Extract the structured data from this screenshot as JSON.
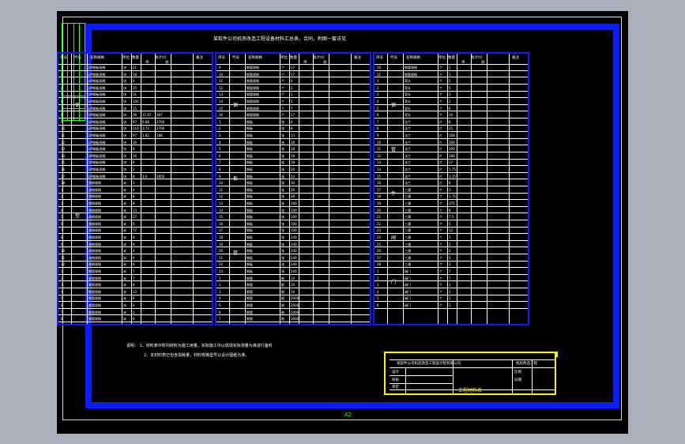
{
  "title": "某软件公司机房改造工程设备材料汇总表，合同，附图一套详见",
  "header": {
    "no": "序号",
    "code": "代号",
    "name": "名称规格",
    "unit": "单位",
    "qty": "数量",
    "total": "总计(t)",
    "sub_a": "单",
    "sub_b": "总",
    "remark": "备注"
  },
  "panels": [
    {
      "groups": [
        "钢",
        "型"
      ],
      "rows": [
        {
          "no": "1",
          "name": "LM钢板规格",
          "unit": "块",
          "qty": "21"
        },
        {
          "no": "2",
          "name": "LM钢板规格",
          "unit": "块",
          "qty": "18"
        },
        {
          "no": "3",
          "name": "LM钢板规格",
          "unit": "块",
          "qty": "4"
        },
        {
          "no": "4",
          "name": "LM钢板规格",
          "unit": "块",
          "qty": "25"
        },
        {
          "no": "5",
          "name": "LM钢板规格",
          "unit": "块",
          "qty": "31"
        },
        {
          "no": "6",
          "name": "LM钢板规格",
          "unit": "块",
          "qty": "100"
        },
        {
          "no": "7",
          "name": "LM钢板规格",
          "unit": "块",
          "qty": "15"
        },
        {
          "no": "8",
          "name": "LM钢板规格",
          "unit": "块",
          "qty": "36",
          "a": "11.67",
          "b": "387"
        },
        {
          "no": "9",
          "name": "LM钢板规格",
          "unit": "块",
          "qty": "97",
          "a": "6.88",
          "b": "2700"
        },
        {
          "no": "10",
          "name": "LM钢板规格",
          "unit": "块",
          "qty": "114",
          "a": "3.72",
          "b": "2700"
        },
        {
          "no": "11",
          "name": "LM钢板规格",
          "unit": "块",
          "qty": "97",
          "a": "1.82",
          "b": "188"
        },
        {
          "no": "12",
          "name": "LM钢板规格",
          "unit": "块",
          "qty": "30"
        },
        {
          "no": "13",
          "name": "LM钢板规格",
          "unit": "块",
          "qty": "8"
        },
        {
          "no": "14",
          "name": "LM钢板规格",
          "unit": "块",
          "qty": "26"
        },
        {
          "no": "15",
          "name": "LM钢板规格",
          "unit": "块",
          "qty": "6"
        },
        {
          "no": "16",
          "name": "LM钢板规格",
          "unit": "块",
          "qty": "2"
        },
        {
          "no": "17",
          "name": "LM钢板规格",
          "unit": "块",
          "qty": "8",
          "a": "3.6",
          "b": "2850"
        },
        {
          "no": "18",
          "name": "角钢规格",
          "unit": "米",
          "qty": "3"
        },
        {
          "no": "1",
          "name": "角钢规格",
          "unit": "米",
          "qty": "4"
        },
        {
          "no": "2",
          "name": "角钢规格",
          "unit": "米",
          "qty": "8"
        },
        {
          "no": "3",
          "name": "角钢规格",
          "unit": "米",
          "qty": "8"
        },
        {
          "no": "4",
          "name": "角钢规格",
          "unit": "米",
          "qty": "13"
        },
        {
          "no": "5",
          "name": "角钢规格",
          "unit": "米",
          "qty": "27"
        },
        {
          "no": "6",
          "name": "角钢规格",
          "unit": "米",
          "qty": "6"
        },
        {
          "no": "7",
          "name": "角钢规格",
          "unit": "米",
          "qty": "77"
        },
        {
          "no": "8",
          "name": "角钢规格",
          "unit": "米",
          "qty": "8"
        },
        {
          "no": "9",
          "name": "角钢规格",
          "unit": "米",
          "qty": "8"
        },
        {
          "no": "10",
          "name": "角钢规格",
          "unit": "米",
          "qty": "4"
        },
        {
          "no": "11",
          "name": "角钢规格",
          "unit": "米",
          "qty": "4"
        },
        {
          "no": "12",
          "name": "角钢规格",
          "unit": "米",
          "qty": "6"
        },
        {
          "no": "1",
          "name": "钢管规格",
          "unit": "米",
          "qty": "7"
        },
        {
          "no": "2",
          "name": "钢管规格",
          "unit": "米",
          "qty": "7"
        },
        {
          "no": "3",
          "name": "钢管规格",
          "unit": "米",
          "qty": "8"
        },
        {
          "no": "4",
          "name": "钢管规格",
          "unit": "米",
          "qty": "13"
        },
        {
          "no": "5",
          "name": "钢管规格",
          "unit": "米",
          "qty": "6"
        },
        {
          "no": "6",
          "name": "钢管规格",
          "unit": "米",
          "qty": "4"
        },
        {
          "no": "7",
          "name": "钢管规格",
          "unit": "米",
          "qty": "2"
        },
        {
          "no": "8",
          "name": "钢管规格",
          "unit": "米",
          "qty": "8"
        }
      ]
    },
    {
      "groups": [
        "钢",
        "板",
        "管"
      ],
      "rows": [
        {
          "no": "9",
          "name": "钢管规格",
          "unit": "个",
          "qty": "17"
        },
        {
          "no": "10",
          "name": "钢管规格",
          "unit": "个",
          "qty": "17"
        },
        {
          "no": "11",
          "name": "钢管规格",
          "unit": "个",
          "qty": "4"
        },
        {
          "no": "12",
          "name": "钢管规格",
          "unit": "个",
          "qty": "2"
        },
        {
          "no": "13",
          "name": "钢管规格",
          "unit": "个",
          "qty": "1"
        },
        {
          "no": "14",
          "name": "钢管规格",
          "unit": "个",
          "qty": "5"
        },
        {
          "no": "15",
          "name": "钢管规格",
          "unit": "个",
          "qty": "7"
        },
        {
          "no": "16",
          "name": "钢管规格",
          "unit": "个",
          "qty": "17"
        },
        {
          "no": "1",
          "name": "钢板",
          "unit": "张",
          "qty": "4"
        },
        {
          "no": "2",
          "name": "钢板",
          "unit": "张",
          "qty": "8"
        },
        {
          "no": "3",
          "name": "钢板",
          "unit": "张",
          "qty": "13"
        },
        {
          "no": "4",
          "name": "钢板",
          "unit": "张",
          "qty": "28"
        },
        {
          "no": "5",
          "name": "钢板",
          "unit": "张",
          "qty": "28"
        },
        {
          "no": "6",
          "name": "钢板",
          "unit": "张",
          "qty": "18"
        },
        {
          "no": "7",
          "name": "钢板",
          "unit": "张",
          "qty": "18"
        },
        {
          "no": "8",
          "name": "钢板",
          "unit": "张",
          "qty": "20"
        },
        {
          "no": "9",
          "name": "钢板",
          "unit": "张",
          "qty": "24"
        },
        {
          "no": "10",
          "name": "钢板",
          "unit": "张",
          "qty": "30"
        },
        {
          "no": "11",
          "name": "钢板",
          "unit": "张",
          "qty": "26"
        },
        {
          "no": "12",
          "name": "钢板",
          "unit": "张",
          "qty": "28"
        },
        {
          "no": "13",
          "name": "钢板",
          "unit": "张",
          "qty": "100"
        },
        {
          "no": "14",
          "name": "钢板",
          "unit": "张",
          "qty": "100"
        },
        {
          "no": "15",
          "name": "钢板",
          "unit": "张",
          "qty": "100"
        },
        {
          "no": "16",
          "name": "钢板",
          "unit": "张",
          "qty": "100"
        },
        {
          "no": "17",
          "name": "钢板",
          "unit": "张",
          "qty": "100"
        },
        {
          "no": "18",
          "name": "钢板",
          "unit": "张",
          "qty": "240"
        },
        {
          "no": "19",
          "name": "钢板",
          "unit": "张",
          "qty": "240"
        },
        {
          "no": "20",
          "name": "钢板",
          "unit": "张",
          "qty": "240"
        },
        {
          "no": "21",
          "name": "钢板",
          "unit": "张",
          "qty": "240"
        },
        {
          "no": "22",
          "name": "钢板",
          "unit": "张",
          "qty": "240"
        },
        {
          "no": "23",
          "name": "钢板",
          "unit": "张",
          "qty": "240"
        },
        {
          "no": "1",
          "name": "钢管",
          "unit": "根",
          "qty": "10"
        },
        {
          "no": "2",
          "name": "钢管",
          "unit": "根",
          "qty": "10"
        },
        {
          "no": "3",
          "name": "钢管",
          "unit": "根",
          "qty": "10"
        },
        {
          "no": "4",
          "name": "钢管",
          "unit": "根",
          "qty": "2000"
        },
        {
          "no": "5",
          "name": "钢管",
          "unit": "根",
          "qty": "2000"
        },
        {
          "no": "6",
          "name": "钢管",
          "unit": "根",
          "qty": "2000"
        },
        {
          "no": "7",
          "name": "钢管",
          "unit": "根",
          "qty": "2000"
        }
      ]
    },
    {
      "groups": [
        "钢",
        "管",
        "件",
        "阀",
        "门"
      ],
      "rows": [
        {
          "no": "10",
          "name": "钢管规格",
          "unit": "个",
          "qty": "1"
        },
        {
          "no": "11",
          "name": "钢管规格",
          "unit": "个",
          "qty": "1"
        },
        {
          "no": "1",
          "name": "弯头",
          "unit": "个",
          "qty": "5"
        },
        {
          "no": "2",
          "name": "弯头",
          "unit": "个",
          "qty": "5"
        },
        {
          "no": "3",
          "name": "弯头",
          "unit": "个",
          "qty": "3"
        },
        {
          "no": "4",
          "name": "弯头",
          "unit": "个",
          "qty": "2"
        },
        {
          "no": "5",
          "name": "弯头",
          "unit": "个",
          "qty": "6"
        },
        {
          "no": "6",
          "name": "弯头",
          "unit": "个",
          "qty": "10"
        },
        {
          "no": "7",
          "name": "法兰",
          "unit": "片",
          "qty": "8"
        },
        {
          "no": "8",
          "name": "法兰",
          "unit": "片",
          "qty": "25"
        },
        {
          "no": "9",
          "name": "法兰",
          "unit": "片",
          "qty": "108"
        },
        {
          "no": "10",
          "name": "法兰",
          "unit": "片",
          "qty": "200"
        },
        {
          "no": "11",
          "name": "法兰",
          "unit": "片",
          "qty": "200"
        },
        {
          "no": "12",
          "name": "法兰",
          "unit": "片",
          "qty": "180"
        },
        {
          "no": "13",
          "name": "法兰",
          "unit": "片",
          "qty": "17"
        },
        {
          "no": "14",
          "name": "法兰",
          "unit": "片",
          "qty": "1.75"
        },
        {
          "no": "15",
          "name": "法兰",
          "unit": "片",
          "qty": "3.15"
        },
        {
          "no": "16",
          "name": "法兰",
          "unit": "片",
          "qty": "6"
        },
        {
          "no": "17",
          "name": "三通",
          "unit": "个",
          "qty": "3"
        },
        {
          "no": "18",
          "name": "三通",
          "unit": "个",
          "qty": "1.75"
        },
        {
          "no": "19",
          "name": "三通",
          "unit": "个",
          "qty": "375"
        },
        {
          "no": "20",
          "name": "三通",
          "unit": "个",
          "qty": "8"
        },
        {
          "no": "21",
          "name": "三通",
          "unit": "个",
          "qty": "7.5"
        },
        {
          "no": "22",
          "name": "三通",
          "unit": "个",
          "qty": "5"
        },
        {
          "no": "23",
          "name": "三通",
          "unit": "个",
          "qty": "12"
        },
        {
          "no": "24",
          "name": "三通",
          "unit": "个",
          "qty": "1"
        },
        {
          "no": "25",
          "name": "三通",
          "unit": "个",
          "qty": "2"
        },
        {
          "no": "26",
          "name": "三通",
          "unit": "个",
          "qty": "2"
        },
        {
          "no": "27",
          "name": "三通",
          "unit": "个",
          "qty": "3"
        },
        {
          "no": "28",
          "name": "三通",
          "unit": "个",
          "qty": "3"
        },
        {
          "no": "1",
          "name": "阀门",
          "unit": "个",
          "qty": "7"
        },
        {
          "no": "2",
          "name": "阀门",
          "unit": "个",
          "qty": "7"
        },
        {
          "no": "3",
          "name": "阀门",
          "unit": "个",
          "qty": "2"
        },
        {
          "no": "4",
          "name": "阀门",
          "unit": "个",
          "qty": "2"
        },
        {
          "no": "5",
          "name": "阀门",
          "unit": "个",
          "qty": "1"
        },
        {
          "no": "6",
          "name": "阀门",
          "unit": "个",
          "qty": "1"
        }
      ]
    }
  ],
  "notes": {
    "label": "说明：",
    "line1": "1、材料表中所列材料为施工用量，实际施工中以现场实际测量为准进行备料",
    "line2": "2、本材料表已包含损耗量，材料规格型号以设计图纸为准。"
  },
  "titleblock": {
    "company": "某软件公司机房改造工程设计院有限公司",
    "project": "机房改造工程",
    "drawing": "工程材料表",
    "design": "设计",
    "check": "校核",
    "approve": "审定",
    "scale": "比例",
    "date": "日期"
  },
  "sheet_size": "A2"
}
